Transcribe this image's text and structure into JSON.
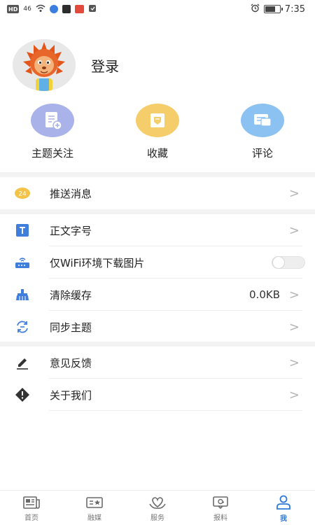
{
  "status_bar": {
    "hd": "HD",
    "signal": "46",
    "time": "7:35",
    "battery_level": 0.72
  },
  "profile": {
    "login_label": "登录"
  },
  "quick_actions": [
    {
      "label": "主题关注",
      "icon": "subscription-add-icon",
      "color": "#a9b2e9"
    },
    {
      "label": "收藏",
      "icon": "favorite-box-icon",
      "color": "#f6cd6b"
    },
    {
      "label": "评论",
      "icon": "comment-icon",
      "color": "#8cc2f2"
    }
  ],
  "settings": {
    "push": {
      "label": "推送消息",
      "icon": "push-badge-icon",
      "badge": "24"
    },
    "font_size": {
      "label": "正文字号",
      "icon": "text-size-icon"
    },
    "wifi_only": {
      "label": "仅WiFi环境下载图片",
      "icon": "router-icon",
      "enabled": false
    },
    "clear_cache": {
      "label": "清除缓存",
      "value": "0.0KB",
      "icon": "broom-icon"
    },
    "sync": {
      "label": "同步主题",
      "icon": "sync-icon"
    },
    "feedback": {
      "label": "意见反馈",
      "icon": "pencil-icon"
    },
    "about": {
      "label": "关于我们",
      "icon": "info-diamond-icon"
    }
  },
  "chevron": ">",
  "tabs": [
    {
      "label": "首页",
      "icon": "newspaper-icon",
      "active": false
    },
    {
      "label": "融媒",
      "icon": "media-icon",
      "active": false
    },
    {
      "label": "服务",
      "icon": "hands-heart-icon",
      "active": false
    },
    {
      "label": "报料",
      "icon": "report-icon",
      "active": false
    },
    {
      "label": "我",
      "icon": "person-icon",
      "active": true
    }
  ],
  "colors": {
    "accent": "#2f7ad8",
    "section_gap": "#f3f3f3",
    "chevron": "#b5b5b5"
  }
}
